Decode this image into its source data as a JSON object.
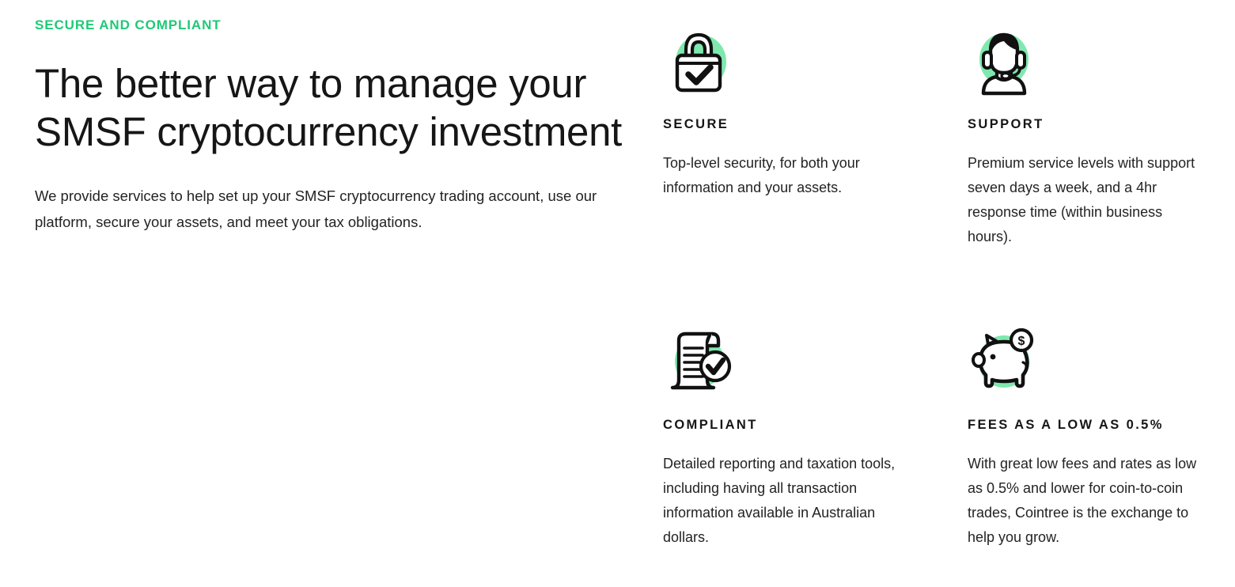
{
  "intro": {
    "eyebrow": "SECURE AND COMPLIANT",
    "headline": "The better way to manage your SMSF cryptocurrency investment",
    "lede": "We provide services to help set up your SMSF cryptocurrency trading account, use our platform, secure your assets, and meet your tax obligations."
  },
  "colors": {
    "accent_green": "#1fc977",
    "blob_green": "#7fe8ae",
    "heading_black": "#161616",
    "body_text": "#232323",
    "background": "#ffffff"
  },
  "features": [
    {
      "icon": "padlock-check-icon",
      "title": "SECURE",
      "text": "Top-level security, for both your information and your assets."
    },
    {
      "icon": "support-agent-headset-icon",
      "title": "SUPPORT",
      "text": "Premium service levels with support seven days a week, and a 4hr response time (within business hours)."
    },
    {
      "icon": "document-check-icon",
      "title": "COMPLIANT",
      "text": "Detailed reporting and taxation tools, including having all transaction information available in Australian dollars."
    },
    {
      "icon": "piggy-bank-coin-icon",
      "title": "FEES AS A LOW AS 0.5%",
      "text": "With great low fees and rates as low as 0.5% and lower for coin-to-coin trades, Cointree is the exchange to help you grow."
    }
  ]
}
